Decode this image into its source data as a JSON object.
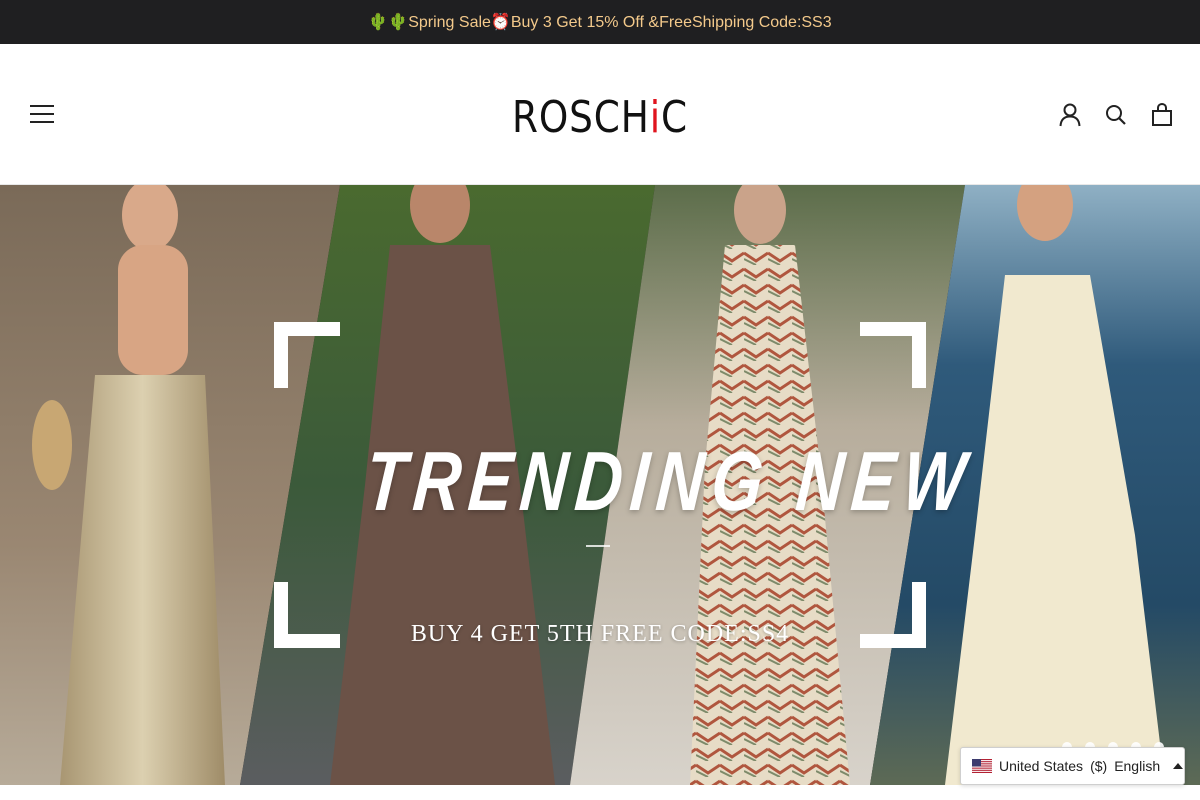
{
  "announcement": {
    "text": "🌵🌵Spring Sale⏰Buy 3 Get 15% Off &FreeShipping Code:SS3"
  },
  "header": {
    "logo": {
      "prefix": "ROSCH",
      "accent": "i",
      "suffix": "C"
    },
    "icons": [
      "hamburger-menu-icon",
      "account-icon",
      "search-icon",
      "cart-bag-icon"
    ]
  },
  "hero": {
    "title": "TRENDING NEW",
    "subtitle": "BUY 4 GET 5TH FREE CODE:SS4",
    "slide_count": 5
  },
  "locale": {
    "country": "United States",
    "currency": "($)",
    "language": "English",
    "flag": "us-flag-icon"
  },
  "colors": {
    "announcement_bg": "#1f1f21",
    "announcement_text": "#f3c98b",
    "logo_accent": "#e0141e"
  }
}
